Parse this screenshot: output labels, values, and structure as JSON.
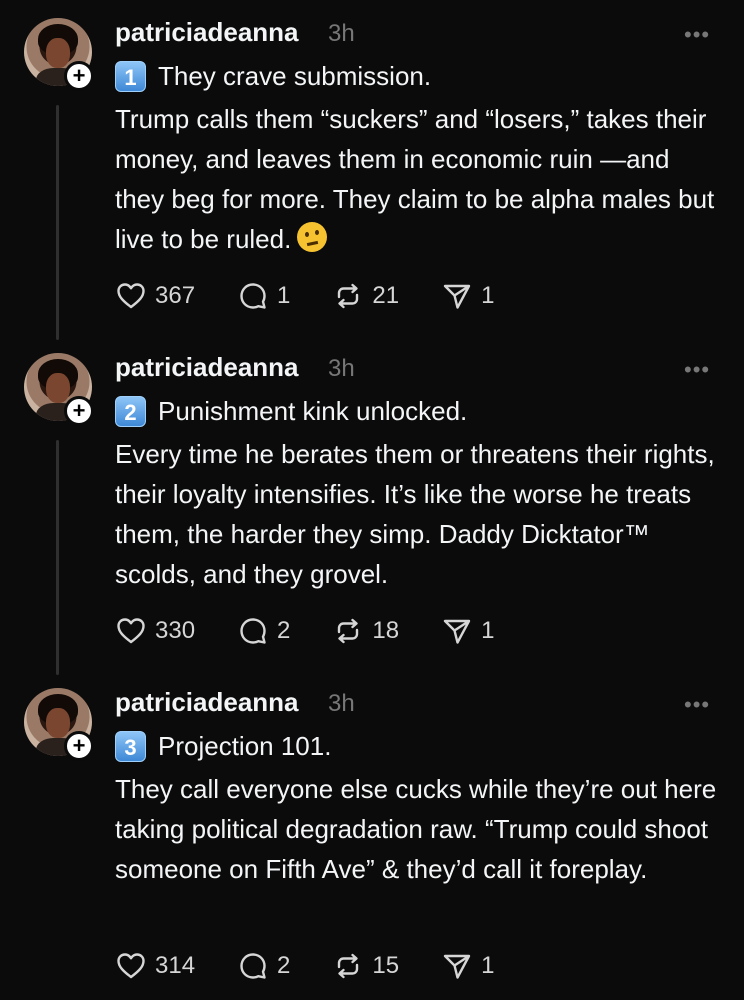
{
  "posts": [
    {
      "username": "patriciadeanna",
      "time": "3h",
      "more": "•••",
      "number": "1",
      "headline": "They crave submission.",
      "body": "Trump calls them “suckers” and “losers,” takes their money, and leaves them in economic ruin —and they beg for more. They claim to be alpha males but live to be ruled.",
      "emoji": "thinking-face",
      "likes": "367",
      "replies": "1",
      "reposts": "21",
      "shares": "1"
    },
    {
      "username": "patriciadeanna",
      "time": "3h",
      "more": "•••",
      "number": "2",
      "headline": "Punishment kink unlocked.",
      "body": "Every time he berates them or threatens their rights, their loyalty intensifies. It’s like the worse he treats them, the harder they simp. Daddy Dicktator™ scolds, and they grovel.",
      "likes": "330",
      "replies": "2",
      "reposts": "18",
      "shares": "1"
    },
    {
      "username": "patriciadeanna",
      "time": "3h",
      "more": "•••",
      "number": "3",
      "headline": "Projection 101.",
      "body": "They call everyone else cucks while they’re out here taking political degradation raw. “Trump could shoot someone on Fifth Ave” & they’d call it foreplay.",
      "likes": "314",
      "replies": "2",
      "reposts": "15",
      "shares": "1"
    }
  ],
  "plus_symbol": "+",
  "colors": {
    "background": "#0b0b0b",
    "text": "#f3f5f7",
    "muted": "#777777",
    "thread_line": "#2f2f2f"
  }
}
